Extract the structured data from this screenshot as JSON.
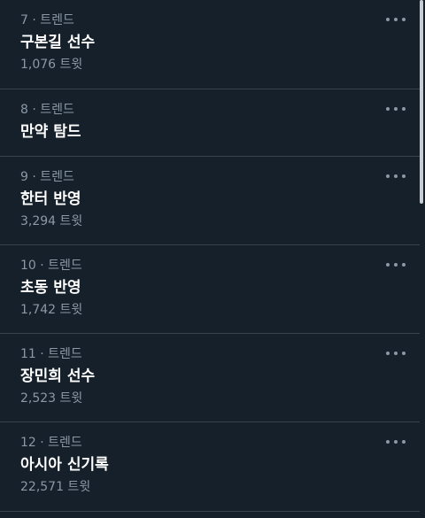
{
  "trends": [
    {
      "meta": "7 · 트렌드",
      "title": "구본길 선수",
      "count": "1,076 트윗"
    },
    {
      "meta": "8 · 트렌드",
      "title": "만약 탐드",
      "count": ""
    },
    {
      "meta": "9 · 트렌드",
      "title": "한터 반영",
      "count": "3,294 트윗"
    },
    {
      "meta": "10 · 트렌드",
      "title": "초동 반영",
      "count": "1,742 트윗"
    },
    {
      "meta": "11 · 트렌드",
      "title": "장민희 선수",
      "count": "2,523 트윗"
    },
    {
      "meta": "12 · 트렌드",
      "title": "아시아 신기록",
      "count": "22,571 트윗"
    }
  ],
  "icons": {
    "more": "more-horizontal-icon"
  },
  "colors": {
    "background": "#15202b",
    "secondary_text": "#8b98a5",
    "divider": "#38444d"
  }
}
